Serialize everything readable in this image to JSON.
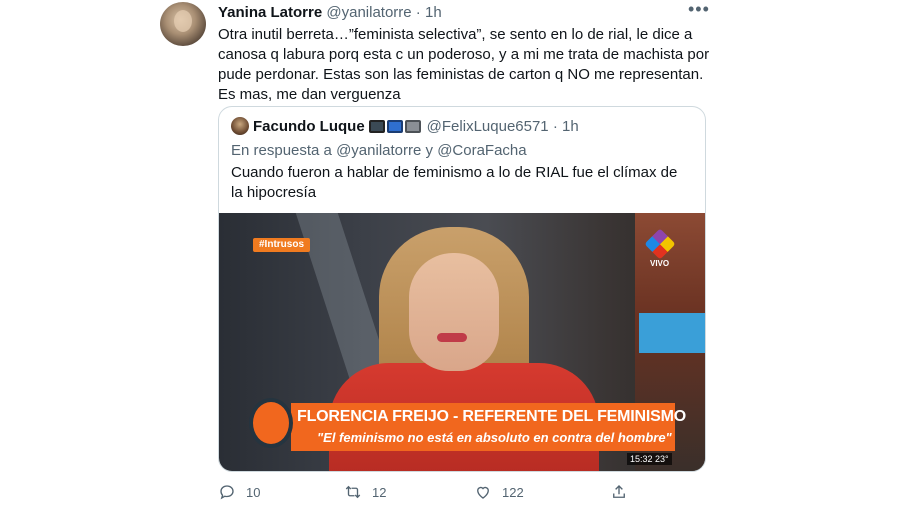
{
  "tweet": {
    "display_name": "Yanina Latorre",
    "handle": "@yanilatorre",
    "separator": " · ",
    "time": "1h",
    "text": "Otra inutil berreta…”feminista selectiva”, se sento en lo de rial, le dice a canosa q labura porq esta c un poderoso, y a mi me trata de machista por pude perdonar. Estas son las feministas de carton q NO me representan. Es mas, me dan verguenza",
    "more_icon": "more-horizontal-icon"
  },
  "quoted": {
    "display_name": "Facundo Luque",
    "emojis": [
      "camera-icon",
      "television-icon",
      "radio-icon"
    ],
    "handle": "@FelixLuque6571",
    "separator": " · ",
    "time": "1h",
    "reply_prefix": "En respuesta a ",
    "reply_user1": "@yanilatorre",
    "reply_joiner": " y ",
    "reply_user2": "@CoraFacha",
    "text": "Cuando fueron a hablar de feminismo a lo de RIAL fue el clímax de la hipocresía",
    "media": {
      "hashtag": "#Intrusos",
      "channel": "VIVO",
      "title": "FLORENCIA FREIJO - REFERENTE DEL FEMINISMO",
      "subtitle": "\"El feminismo no está en absoluto en contra del hombre\"",
      "timestamp": "15:32  23°"
    }
  },
  "actions": {
    "reply_count": "10",
    "retweet_count": "12",
    "like_count": "122",
    "reply_icon": "reply-icon",
    "retweet_icon": "retweet-icon",
    "like_icon": "heart-icon",
    "share_icon": "share-icon"
  },
  "colors": {
    "text": "#0f1419",
    "secondary": "#536471",
    "border": "#cfd9de",
    "accent_orange": "#f1671e"
  }
}
